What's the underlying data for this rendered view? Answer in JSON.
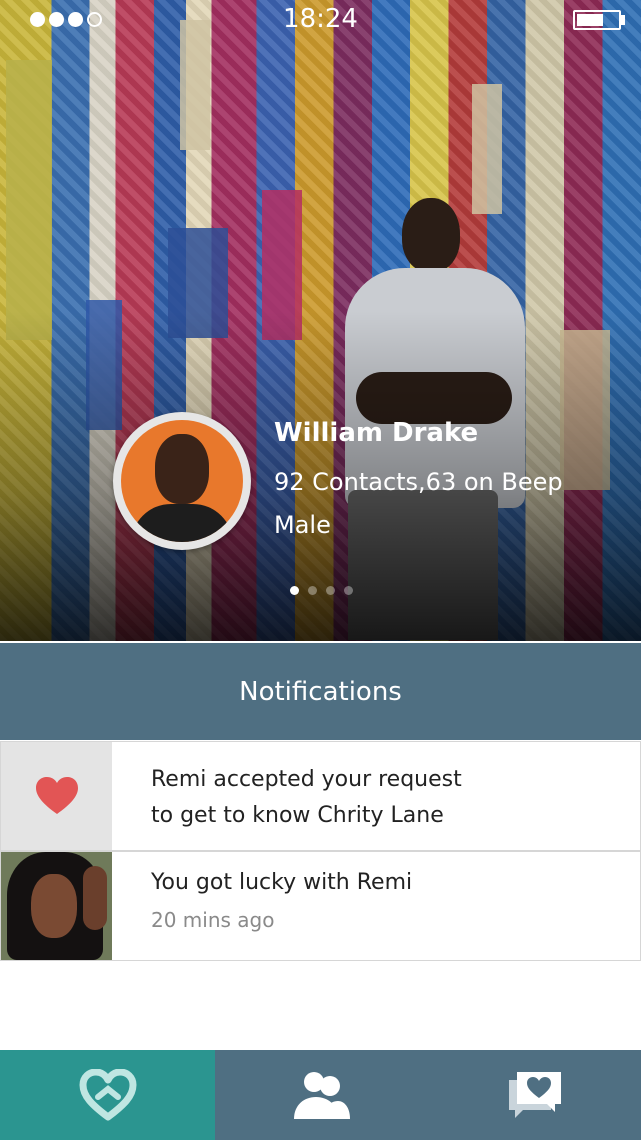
{
  "status_bar": {
    "time": "18:24"
  },
  "profile": {
    "name": "William Drake",
    "contacts": "92 Contacts,63 on Beep",
    "gender": "Male"
  },
  "carousel": {
    "pages": 4,
    "active_page": 1
  },
  "notifications": {
    "header": "Notifications",
    "items": [
      {
        "line1": "Remi accepted your request",
        "line2": "to get to know Chrity Lane",
        "icon": "heart-icon"
      },
      {
        "title": "You got lucky with Remi",
        "time": "20 mins ago"
      }
    ]
  },
  "tab_bar": {
    "tabs": [
      {
        "icon": "heart-outline-icon",
        "active": true
      },
      {
        "icon": "contacts-icon",
        "active": false
      },
      {
        "icon": "message-heart-icon",
        "active": false
      }
    ]
  },
  "colors": {
    "header_bg": "#4f6f82",
    "active_tab": "#2b9590",
    "heart": "#e25555"
  }
}
